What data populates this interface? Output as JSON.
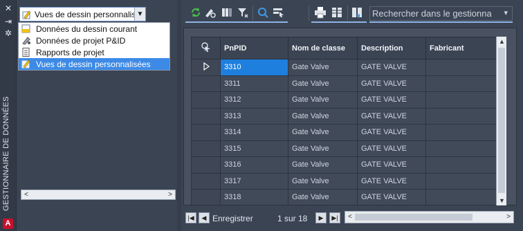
{
  "palette": {
    "title": "GESTIONNAIRE DE DONNÉES",
    "close_icon": "close-icon",
    "autohide_icon": "autohide-icon",
    "properties_icon": "properties-icon",
    "app_badge": "A"
  },
  "view_selector": {
    "selected": "Vues de dessin personnalis",
    "options": [
      {
        "label": "Données du dessin courant",
        "icon": "drawing-data-icon"
      },
      {
        "label": "Données de projet P&ID",
        "icon": "project-data-icon"
      },
      {
        "label": "Rapports de projet",
        "icon": "report-icon"
      },
      {
        "label": "Vues de dessin personnalisées",
        "icon": "custom-view-icon",
        "selected": true
      }
    ]
  },
  "toolbar": {
    "search_placeholder": "Rechercher dans le gestionna",
    "icons": [
      "refresh-icon",
      "zoom-to-icon",
      "hide-columns-icon",
      "filter-clear-icon",
      "zoom-icon",
      "select-icon",
      "print-icon",
      "export-icon",
      "import-icon"
    ]
  },
  "grid": {
    "columns": [
      "PnPID",
      "Nom de classe",
      "Description",
      "Fabricant"
    ],
    "rows": [
      {
        "pnpid": "3310",
        "classe": "Gate Valve",
        "description": "GATE VALVE",
        "fabricant": "",
        "current": true
      },
      {
        "pnpid": "3311",
        "classe": "Gate Valve",
        "description": "GATE VALVE",
        "fabricant": ""
      },
      {
        "pnpid": "3312",
        "classe": "Gate Valve",
        "description": "GATE VALVE",
        "fabricant": ""
      },
      {
        "pnpid": "3313",
        "classe": "Gate Valve",
        "description": "GATE VALVE",
        "fabricant": ""
      },
      {
        "pnpid": "3314",
        "classe": "Gate Valve",
        "description": "GATE VALVE",
        "fabricant": ""
      },
      {
        "pnpid": "3315",
        "classe": "Gate Valve",
        "description": "GATE VALVE",
        "fabricant": ""
      },
      {
        "pnpid": "3316",
        "classe": "Gate Valve",
        "description": "GATE VALVE",
        "fabricant": ""
      },
      {
        "pnpid": "3317",
        "classe": "Gate Valve",
        "description": "GATE VALVE",
        "fabricant": ""
      },
      {
        "pnpid": "3318",
        "classe": "Gate Valve",
        "description": "GATE VALVE",
        "fabricant": ""
      }
    ]
  },
  "navigator": {
    "label": "Enregistrer",
    "position": "1 sur 18"
  }
}
